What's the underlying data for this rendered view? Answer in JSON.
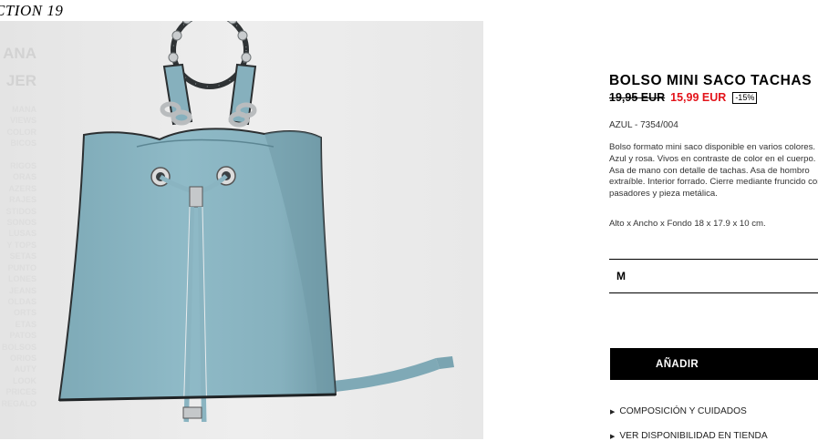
{
  "collection": "CTION 19",
  "sidebar": {
    "big": [
      "ANA",
      "JER"
    ],
    "small": [
      "MANA",
      "VIEWS",
      "COLOR",
      "BICOS",
      "",
      "RIGOS",
      "ORAS",
      "AZERS",
      "RAJES",
      "STIDOS",
      "SONOS",
      "LUSAS",
      "Y TOPS",
      "SETAS",
      "PUNTO",
      "LONES",
      "JEANS",
      "OLDAS",
      "ORTS",
      "ETAS",
      "PATOS",
      "BOLSOS",
      "ORIOS",
      "AUTY",
      "LOOK",
      "PRICES",
      "REGALO"
    ]
  },
  "product": {
    "title": "BOLSO MINI SACO TACHAS",
    "old_price": "19,95 EUR",
    "new_price": "15,99 EUR",
    "discount": "-15%",
    "color_ref": "AZUL - 7354/004",
    "description": "Bolso formato mini saco disponible en varios colores. Azul y rosa. Vivos en contraste de color en el cuerpo. Asa de mano con detalle de tachas. Asa de hombro extraíble. Interior forrado. Cierre mediante fruncido con pasadores y pieza metálica.",
    "dimensions": "Alto x Ancho x Fondo 18 x 17.9 x 10 cm.",
    "size": "M",
    "add_label": "AÑADIR",
    "link1": "COMPOSICIÓN Y CUIDADOS",
    "link2": "VER DISPONIBILIDAD EN TIENDA"
  },
  "colors": {
    "bag": "#8db7c4",
    "accent_red": "#e3141b",
    "button_bg": "#000000"
  }
}
